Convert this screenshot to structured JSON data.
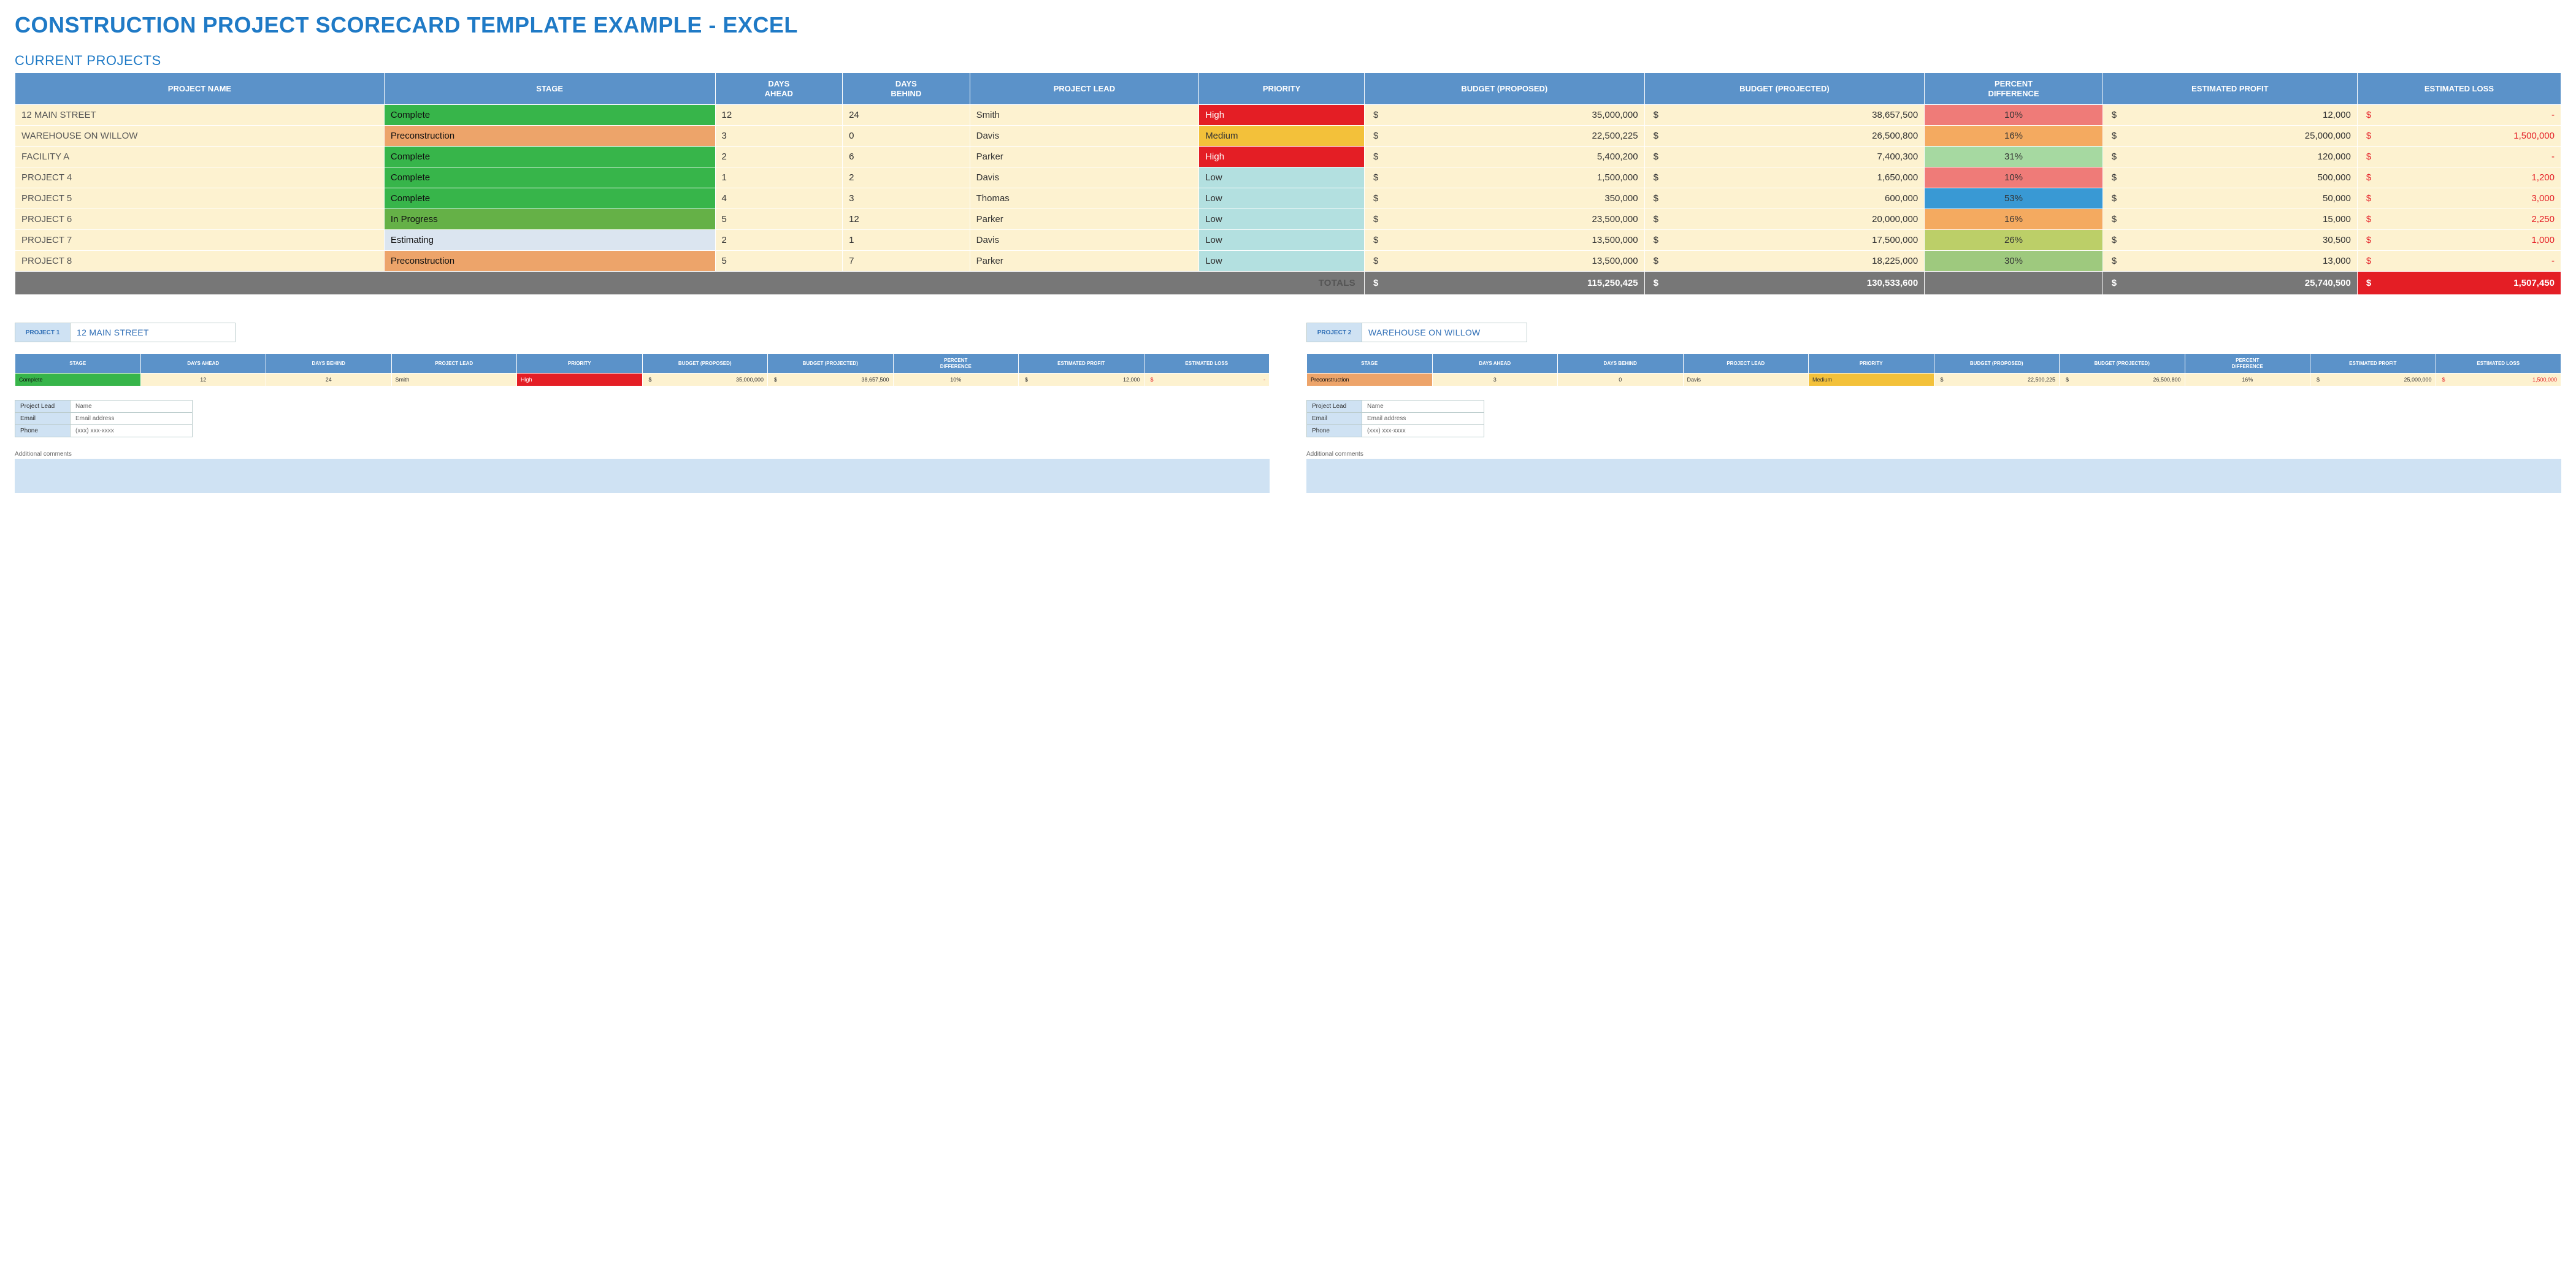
{
  "title": "CONSTRUCTION PROJECT SCORECARD TEMPLATE EXAMPLE - EXCEL",
  "section": "CURRENT PROJECTS",
  "columns": [
    "PROJECT NAME",
    "STAGE",
    "DAYS AHEAD",
    "DAYS BEHIND",
    "PROJECT LEAD",
    "PRIORITY",
    "BUDGET (PROPOSED)",
    "BUDGET (PROJECTED)",
    "PERCENT DIFFERENCE",
    "ESTIMATED PROFIT",
    "ESTIMATED LOSS"
  ],
  "rows": [
    {
      "name": "12 MAIN STREET",
      "stage": "Complete",
      "stageClass": "stage-complete",
      "daysAhead": "12",
      "daysBehind": "24",
      "lead": "Smith",
      "priority": "High",
      "prioClass": "prio-high",
      "budgetProp": "35,000,000",
      "budgetProj": "38,657,500",
      "pct": "10%",
      "pctClass": "pct-red",
      "profit": "12,000",
      "loss": "-"
    },
    {
      "name": "WAREHOUSE ON WILLOW",
      "stage": "Preconstruction",
      "stageClass": "stage-preconstruction",
      "daysAhead": "3",
      "daysBehind": "0",
      "lead": "Davis",
      "priority": "Medium",
      "prioClass": "prio-medium",
      "budgetProp": "22,500,225",
      "budgetProj": "26,500,800",
      "pct": "16%",
      "pctClass": "pct-orange",
      "profit": "25,000,000",
      "loss": "1,500,000"
    },
    {
      "name": "FACILITY A",
      "stage": "Complete",
      "stageClass": "stage-complete",
      "daysAhead": "2",
      "daysBehind": "6",
      "lead": "Parker",
      "priority": "High",
      "prioClass": "prio-high",
      "budgetProp": "5,400,200",
      "budgetProj": "7,400,300",
      "pct": "31%",
      "pctClass": "pct-green",
      "profit": "120,000",
      "loss": "-"
    },
    {
      "name": "PROJECT 4",
      "stage": "Complete",
      "stageClass": "stage-complete",
      "daysAhead": "1",
      "daysBehind": "2",
      "lead": "Davis",
      "priority": "Low",
      "prioClass": "prio-low",
      "budgetProp": "1,500,000",
      "budgetProj": "1,650,000",
      "pct": "10%",
      "pctClass": "pct-red",
      "profit": "500,000",
      "loss": "1,200"
    },
    {
      "name": "PROJECT 5",
      "stage": "Complete",
      "stageClass": "stage-complete",
      "daysAhead": "4",
      "daysBehind": "3",
      "lead": "Thomas",
      "priority": "Low",
      "prioClass": "prio-low",
      "budgetProp": "350,000",
      "budgetProj": "600,000",
      "pct": "53%",
      "pctClass": "pct-blue",
      "profit": "50,000",
      "loss": "3,000"
    },
    {
      "name": "PROJECT 6",
      "stage": "In Progress",
      "stageClass": "stage-inprogress",
      "daysAhead": "5",
      "daysBehind": "12",
      "lead": "Parker",
      "priority": "Low",
      "prioClass": "prio-low",
      "budgetProp": "23,500,000",
      "budgetProj": "20,000,000",
      "pct": "16%",
      "pctClass": "pct-orange",
      "profit": "15,000",
      "loss": "2,250"
    },
    {
      "name": "PROJECT 7",
      "stage": "Estimating",
      "stageClass": "stage-estimating",
      "daysAhead": "2",
      "daysBehind": "1",
      "lead": "Davis",
      "priority": "Low",
      "prioClass": "prio-low",
      "budgetProp": "13,500,000",
      "budgetProj": "17,500,000",
      "pct": "26%",
      "pctClass": "pct-olive",
      "profit": "30,500",
      "loss": "1,000"
    },
    {
      "name": "PROJECT 8",
      "stage": "Preconstruction",
      "stageClass": "stage-preconstruction",
      "daysAhead": "5",
      "daysBehind": "7",
      "lead": "Parker",
      "priority": "Low",
      "prioClass": "prio-low",
      "budgetProp": "13,500,000",
      "budgetProj": "18,225,000",
      "pct": "30%",
      "pctClass": "pct-lightgreen",
      "profit": "13,000",
      "loss": "-"
    }
  ],
  "totals": {
    "label": "TOTALS",
    "budgetProp": "115,250,425",
    "budgetProj": "130,533,600",
    "profit": "25,740,500",
    "loss": "1,507,450"
  },
  "miniColumns": [
    "STAGE",
    "DAYS AHEAD",
    "DAYS BEHIND",
    "PROJECT LEAD",
    "PRIORITY",
    "BUDGET (PROPOSED)",
    "BUDGET (PROJECTED)",
    "PERCENT DIFFERENCE",
    "ESTIMATED PROFIT",
    "ESTIMATED LOSS"
  ],
  "details": [
    {
      "tag": "PROJECT 1",
      "name": "12 MAIN STREET",
      "row": {
        "stage": "Complete",
        "stageClass": "stage-complete",
        "daysAhead": "12",
        "daysBehind": "24",
        "lead": "Smith",
        "priority": "High",
        "prioClass": "prio-high",
        "budgetProp": "35,000,000",
        "budgetProj": "38,657,500",
        "pct": "10%",
        "profit": "12,000",
        "loss": "-"
      }
    },
    {
      "tag": "PROJECT 2",
      "name": "WAREHOUSE ON WILLOW",
      "row": {
        "stage": "Preconstruction",
        "stageClass": "stage-preconstruction",
        "daysAhead": "3",
        "daysBehind": "0",
        "lead": "Davis",
        "priority": "Medium",
        "prioClass": "prio-medium",
        "budgetProp": "22,500,225",
        "budgetProj": "26,500,800",
        "pct": "16%",
        "profit": "25,000,000",
        "loss": "1,500,000"
      }
    }
  ],
  "contact": {
    "fields": [
      "Project Lead",
      "Email",
      "Phone"
    ],
    "values": [
      "Name",
      "Email address",
      "(xxx) xxx-xxxx"
    ]
  },
  "commentsLabel": "Additional comments",
  "chart_data": {
    "type": "table",
    "title": "Construction Project Scorecard",
    "columns": [
      "PROJECT NAME",
      "STAGE",
      "DAYS AHEAD",
      "DAYS BEHIND",
      "PROJECT LEAD",
      "PRIORITY",
      "BUDGET (PROPOSED)",
      "BUDGET (PROJECTED)",
      "PERCENT DIFFERENCE",
      "ESTIMATED PROFIT",
      "ESTIMATED LOSS"
    ],
    "rows": [
      [
        "12 MAIN STREET",
        "Complete",
        12,
        24,
        "Smith",
        "High",
        35000000,
        38657500,
        0.1,
        12000,
        0
      ],
      [
        "WAREHOUSE ON WILLOW",
        "Preconstruction",
        3,
        0,
        "Davis",
        "Medium",
        22500225,
        26500800,
        0.16,
        25000000,
        1500000
      ],
      [
        "FACILITY A",
        "Complete",
        2,
        6,
        "Parker",
        "High",
        5400200,
        7400300,
        0.31,
        120000,
        0
      ],
      [
        "PROJECT 4",
        "Complete",
        1,
        2,
        "Davis",
        "Low",
        1500000,
        1650000,
        0.1,
        500000,
        1200
      ],
      [
        "PROJECT 5",
        "Complete",
        4,
        3,
        "Thomas",
        "Low",
        350000,
        600000,
        0.53,
        50000,
        3000
      ],
      [
        "PROJECT 6",
        "In Progress",
        5,
        12,
        "Parker",
        "Low",
        23500000,
        20000000,
        0.16,
        15000,
        2250
      ],
      [
        "PROJECT 7",
        "Estimating",
        2,
        1,
        "Davis",
        "Low",
        13500000,
        17500000,
        0.26,
        30500,
        1000
      ],
      [
        "PROJECT 8",
        "Preconstruction",
        5,
        7,
        "Parker",
        "Low",
        13500000,
        18225000,
        0.3,
        13000,
        0
      ]
    ],
    "totals": {
      "BUDGET (PROPOSED)": 115250425,
      "BUDGET (PROJECTED)": 130533600,
      "ESTIMATED PROFIT": 25740500,
      "ESTIMATED LOSS": 1507450
    }
  }
}
